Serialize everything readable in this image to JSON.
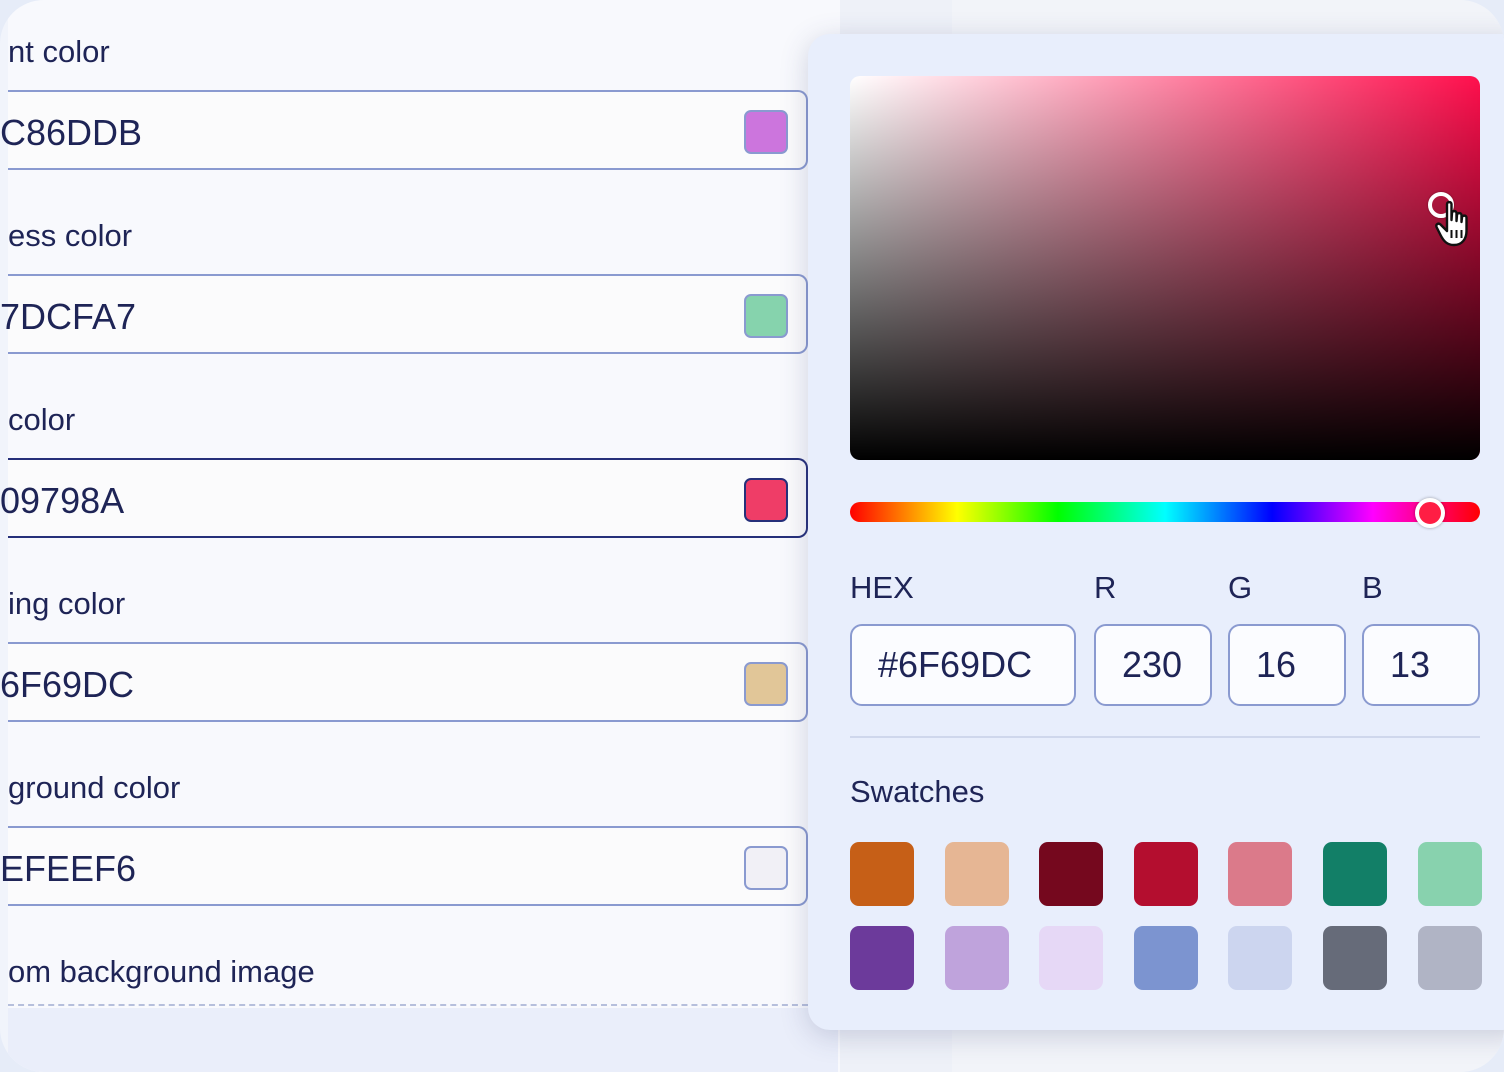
{
  "fields": [
    {
      "label": "nt color",
      "value": "C86DDB",
      "color": "#cc75dd",
      "focused": false
    },
    {
      "label": "ess color",
      "value": "7DCFA7",
      "color": "#86d3ad",
      "focused": false
    },
    {
      "label": " color",
      "value": "09798A",
      "color": "#ef3d67",
      "focused": true
    },
    {
      "label": "ing color",
      "value": "6F69DC",
      "color": "#e1c698",
      "focused": false
    },
    {
      "label": "ground color",
      "value": "EFEEF6",
      "color": "#f1f0f6",
      "focused": false
    },
    {
      "label": "om background image"
    }
  ],
  "picker": {
    "hue_color": "#ff0f4d",
    "hex_label": "HEX",
    "hex_value": "#6F69DC",
    "r_label": "R",
    "r_value": "230",
    "g_label": "G",
    "g_value": "16",
    "b_label": "B",
    "b_value": "13",
    "swatches_title": "Swatches",
    "swatches": [
      "#c65f17",
      "#e6b694",
      "#75081e",
      "#b40e2f",
      "#db7a8a",
      "#127f67",
      "#88d2ae",
      "#6c3a9b",
      "#bfa3dc",
      "#e6d8f6",
      "#7c94d0",
      "#ccd5ef",
      "#666b79",
      "#b0b4c5"
    ]
  }
}
